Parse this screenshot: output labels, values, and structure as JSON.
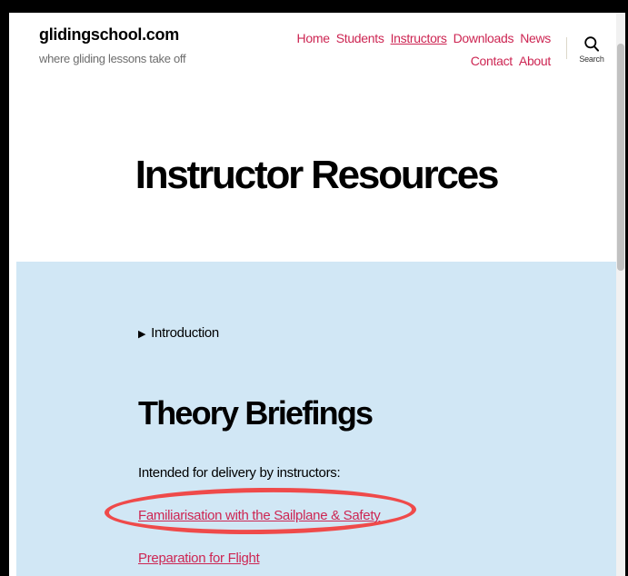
{
  "site": {
    "title": "glidingschool.com",
    "tagline": "where gliding lessons take off"
  },
  "nav": {
    "items": [
      {
        "label": "Home"
      },
      {
        "label": "Students"
      },
      {
        "label": "Instructors"
      },
      {
        "label": "Downloads"
      },
      {
        "label": "News"
      },
      {
        "label": "Contact"
      },
      {
        "label": "About"
      }
    ],
    "current": "Instructors"
  },
  "search": {
    "label": "Search",
    "icon": "search-icon"
  },
  "page": {
    "title": "Instructor Resources"
  },
  "content": {
    "details_summary": "Introduction",
    "section_heading": "Theory Briefings",
    "intro_text": "Intended for delivery by instructors:",
    "links": [
      {
        "label": "Familiarisation with the Sailplane & Safety",
        "highlighted": true
      },
      {
        "label": "Preparation for Flight",
        "highlighted": false
      }
    ]
  },
  "colors": {
    "link": "#cd2653",
    "content_background": "#d1e7f5",
    "annotation": "#ef4a4a",
    "tagline": "#6d6d6d"
  }
}
